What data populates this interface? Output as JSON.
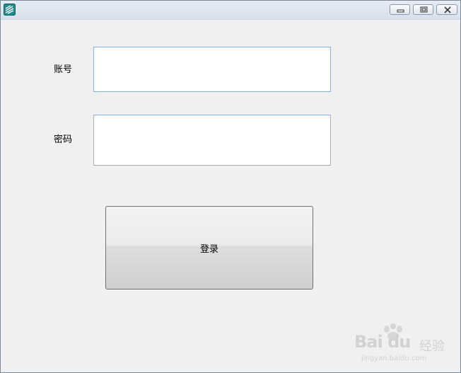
{
  "window": {
    "controls": {
      "minimize_icon": "minimize-icon",
      "maximize_icon": "maximize-icon",
      "close_icon": "close-icon"
    }
  },
  "form": {
    "account_label": "账号",
    "account_value": "",
    "password_label": "密码",
    "password_value": "",
    "login_label": "登录"
  },
  "watermark": {
    "brand": "Bai du",
    "brand_cn": "经验",
    "url": "jingyan.baidu.com"
  },
  "colors": {
    "window_bg": "#f0f0f0",
    "title_bar": "#dde5ee",
    "field_focus_border": "#7eb4ea"
  }
}
